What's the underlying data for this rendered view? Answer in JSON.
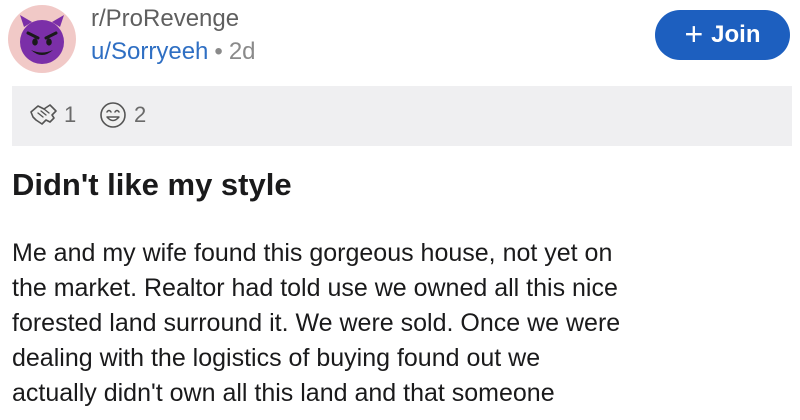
{
  "header": {
    "avatar_icon": "devil-face-icon",
    "subreddit": "r/ProRevenge",
    "username": "u/Sorryeeh",
    "separator": "•",
    "age": "2d",
    "join_label": "Join"
  },
  "awards": [
    {
      "icon": "handshake-icon",
      "count": "1"
    },
    {
      "icon": "grin-face-icon",
      "count": "2"
    }
  ],
  "post": {
    "title": "Didn't like my style",
    "body_lines": [
      "Me and my wife found this gorgeous house, not yet on",
      "the market. Realtor had told use we owned all this nice",
      "forested land surround it.  We were sold.  Once we were",
      "dealing with the logistics of buying found out we",
      "actually didn't own all this land and that someone"
    ]
  },
  "colors": {
    "join_button": "#1d5fbf",
    "username": "#2f6fc3",
    "awards_bar": "#efeff1",
    "avatar_purple": "#7b2fa8"
  }
}
